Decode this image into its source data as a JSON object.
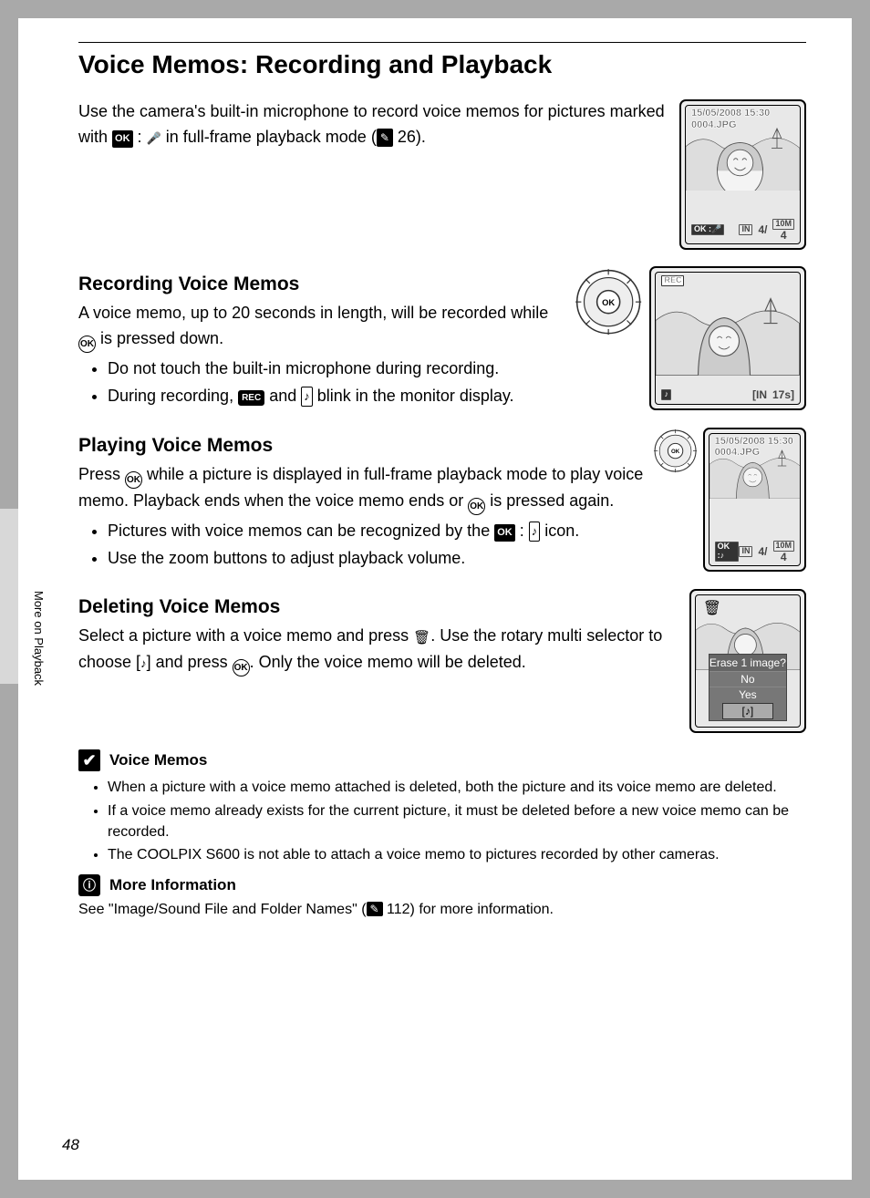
{
  "title": "Voice Memos: Recording and Playback",
  "intro": {
    "p1a": "Use the camera's built-in microphone to record voice memos for pictures marked with ",
    "p1b": " in full-frame playback mode (",
    "p1_ref": "26",
    "p1c": ")."
  },
  "recording": {
    "heading": "Recording Voice Memos",
    "p1a": "A voice memo, up to 20 seconds in length, will be recorded while ",
    "p1b": " is pressed down.",
    "li1": "Do not touch the built-in microphone during recording.",
    "li2a": "During recording, ",
    "li2b": " and ",
    "li2c": " blink in the monitor display."
  },
  "playing": {
    "heading": "Playing Voice Memos",
    "p1a": "Press ",
    "p1b": " while a picture is displayed in full-frame playback mode to play voice memo. Playback ends when the voice memo ends or ",
    "p1c": " is pressed again.",
    "li1a": "Pictures with voice memos can be recognized by the ",
    "li1b": " icon.",
    "li2": "Use the zoom buttons to adjust playback volume."
  },
  "deleting": {
    "heading": "Deleting Voice Memos",
    "p1a": "Select a picture with a voice memo and press ",
    "p1b": ". Use the rotary multi selector to choose ",
    "p1c": " and press ",
    "p1d": ". Only the voice memo will be deleted."
  },
  "notes": {
    "heading": "Voice Memos",
    "li1": "When a picture with a voice memo attached is deleted, both the picture and its voice memo are deleted.",
    "li2": "If a voice memo already exists for the current picture, it must be deleted before a new voice memo can be recorded.",
    "li3": "The COOLPIX S600 is not able to attach a voice memo to pictures recorded by other cameras."
  },
  "moreinfo": {
    "heading": "More Information",
    "text_a": "See \"Image/Sound File and Folder Names\" (",
    "ref": "112",
    "text_b": ") for more information."
  },
  "lcd": {
    "date": "15/05/2008 15:30",
    "file": "0004.JPG",
    "count": "4/",
    "total": "4",
    "rec": "REC",
    "time": "17s",
    "in": "IN",
    "tenm": "10M"
  },
  "erase": {
    "title": "Erase 1 image?",
    "no": "No",
    "yes": "Yes"
  },
  "icons": {
    "ok": "OK",
    "ok_small": "OK",
    "note": "♪"
  },
  "side": "More on Playback",
  "page": "48"
}
